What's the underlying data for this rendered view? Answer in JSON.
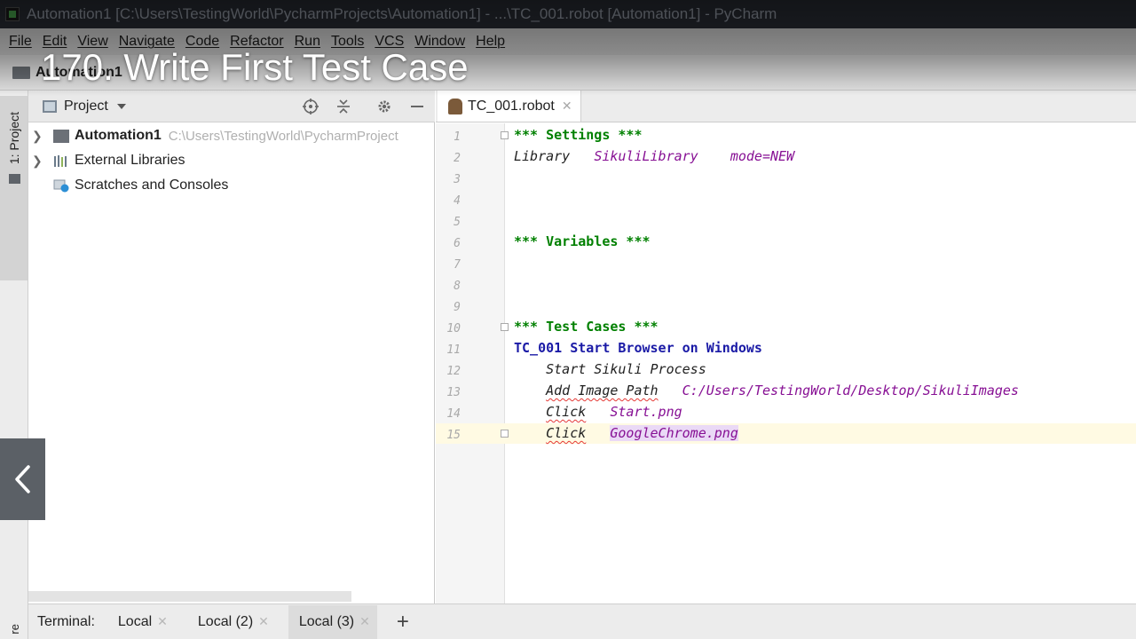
{
  "window": {
    "title": "Automation1 [C:\\Users\\TestingWorld\\PycharmProjects\\Automation1] - ...\\TC_001.robot [Automation1] - PyCharm"
  },
  "menu": [
    "File",
    "Edit",
    "View",
    "Navigate",
    "Code",
    "Refactor",
    "Run",
    "Tools",
    "VCS",
    "Window",
    "Help"
  ],
  "breadcrumb": {
    "project": "Automation1"
  },
  "video": {
    "title": "170. Write First Test Case"
  },
  "left_strip": {
    "project_tab": "1: Project",
    "bottom_label": "re"
  },
  "project_panel": {
    "title": "Project",
    "tree": [
      {
        "label": "Automation1",
        "path": "C:\\Users\\TestingWorld\\PycharmProject",
        "icon": "folder-icon"
      },
      {
        "label": "External Libraries",
        "path": "",
        "icon": "library-icon"
      },
      {
        "label": "Scratches and Consoles",
        "path": "",
        "icon": "scratches-icon"
      }
    ]
  },
  "editor": {
    "tab": "TC_001.robot",
    "current_line": 15,
    "lines": [
      {
        "n": "1",
        "parts": [
          {
            "t": "*** Settings ***",
            "c": "sec"
          }
        ]
      },
      {
        "n": "2",
        "parts": [
          {
            "t": "Library   ",
            "c": "kw"
          },
          {
            "t": "SikuliLibrary    mode=NEW",
            "c": "lib"
          }
        ]
      },
      {
        "n": "3",
        "parts": []
      },
      {
        "n": "4",
        "parts": []
      },
      {
        "n": "5",
        "parts": []
      },
      {
        "n": "6",
        "parts": [
          {
            "t": "*** Variables ***",
            "c": "sec"
          }
        ]
      },
      {
        "n": "7",
        "parts": []
      },
      {
        "n": "8",
        "parts": []
      },
      {
        "n": "9",
        "parts": []
      },
      {
        "n": "10",
        "parts": [
          {
            "t": "*** Test Cases ***",
            "c": "sec"
          }
        ]
      },
      {
        "n": "11",
        "parts": [
          {
            "t": "TC_001 Start Browser on Windows",
            "c": "tc"
          }
        ]
      },
      {
        "n": "12",
        "parts": [
          {
            "t": "    Start Sikuli Process",
            "c": "kw"
          }
        ]
      },
      {
        "n": "13",
        "parts": [
          {
            "t": "    ",
            "c": "kw"
          },
          {
            "t": "Add Image Path",
            "c": "kw squig"
          },
          {
            "t": "   ",
            "c": "kw"
          },
          {
            "t": "C:/Users/TestingWorld/Desktop/SikuliImages",
            "c": "arg"
          }
        ]
      },
      {
        "n": "14",
        "parts": [
          {
            "t": "    ",
            "c": "kw"
          },
          {
            "t": "Click",
            "c": "kw squig"
          },
          {
            "t": "   ",
            "c": "kw"
          },
          {
            "t": "Start.png",
            "c": "arg"
          }
        ]
      },
      {
        "n": "15",
        "parts": [
          {
            "t": "    ",
            "c": "kw"
          },
          {
            "t": "Click",
            "c": "kw squig"
          },
          {
            "t": "   ",
            "c": "kw"
          },
          {
            "t": "GoogleChrome.png",
            "c": "arg hl"
          }
        ]
      }
    ]
  },
  "terminal": {
    "label": "Terminal:",
    "tabs": [
      "Local",
      "Local (2)",
      "Local (3)"
    ],
    "active_tab": 2,
    "add_label": "+"
  },
  "colors": {
    "section": "#008000",
    "testcase": "#1a1aa6",
    "argument": "#871094",
    "current_line": "#fffae3"
  }
}
